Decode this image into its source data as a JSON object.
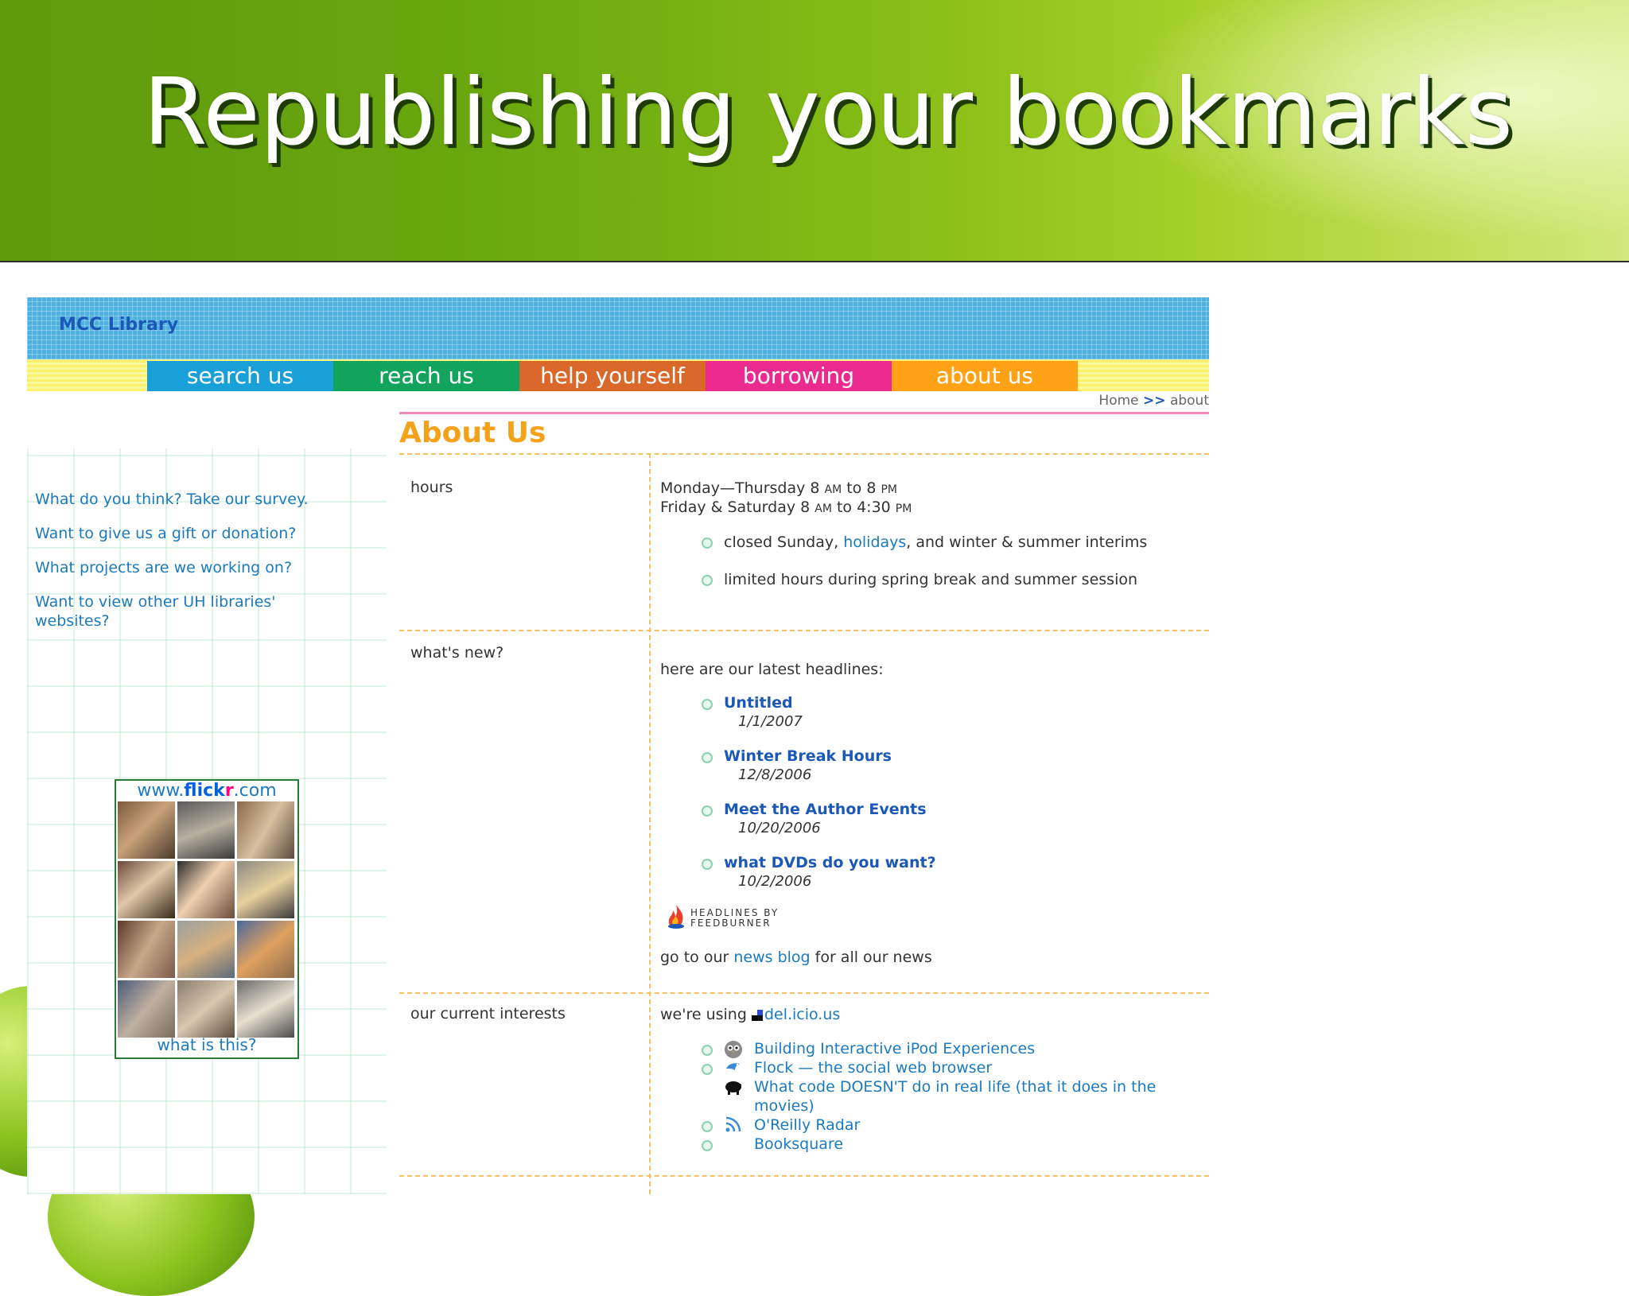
{
  "slide": {
    "title": "Republishing your bookmarks"
  },
  "site": {
    "name": "MCC Library",
    "nav": [
      "search us",
      "reach us",
      "help yourself",
      "borrowing",
      "about us"
    ],
    "breadcrumb": {
      "home": "Home",
      "separator": ">>",
      "current": "about"
    },
    "page_title": "About Us"
  },
  "sidebar": {
    "links": [
      "What do you think? Take our survey.",
      "Want to give us a gift or donation?",
      "What projects are we working on?",
      "Want to view other UH libraries' websites?"
    ],
    "flickr": {
      "prefix": "www.",
      "brand_a": "flick",
      "brand_b": "r",
      "suffix": ".com",
      "caption": "what is this?"
    }
  },
  "content": {
    "hours": {
      "label": "hours",
      "line1_days": "Monday—Thursday 8 ",
      "line1_am": "AM",
      "line1_to": " to 8 ",
      "line1_pm": "PM",
      "line2_days": "Friday & Saturday 8 ",
      "line2_am": "AM",
      "line2_to": " to 4:30 ",
      "line2_pm": "PM",
      "bullet1_a": "closed Sunday, ",
      "bullet1_link": "holidays",
      "bullet1_b": ", and winter & summer interims",
      "bullet2": "limited hours during spring break and summer session"
    },
    "whats_new": {
      "label": "what's new?",
      "intro": "here are our latest headlines:",
      "headlines": [
        {
          "title": "Untitled",
          "date": "1/1/2007"
        },
        {
          "title": "Winter Break Hours",
          "date": "12/8/2006"
        },
        {
          "title": "Meet the Author Events",
          "date": "10/20/2006"
        },
        {
          "title": "what DVDs do you want?",
          "date": "10/2/2006"
        }
      ],
      "feedburner_line1": "HEADLINES BY",
      "feedburner_line2": "FEEDBURNER",
      "footer_a": "go to our ",
      "footer_link": "news blog",
      "footer_b": " for all our news"
    },
    "interests": {
      "label": "our current interests",
      "intro": "we're using ",
      "service": "del.icio.us",
      "items": [
        "Building Interactive iPod Experiences",
        "Flock — the social web browser",
        "What code DOESN'T do in real life (that it does in the movies)",
        "O'Reilly Radar",
        "Booksquare"
      ]
    }
  },
  "colors": {
    "nav_search": "#1aa0d8",
    "nav_reach": "#12a35c",
    "nav_help": "#d9682a",
    "nav_borrow": "#ea2a8e",
    "nav_about": "#ffa216",
    "title_orange": "#f5a21b",
    "link_blue": "#1b7ac0"
  }
}
